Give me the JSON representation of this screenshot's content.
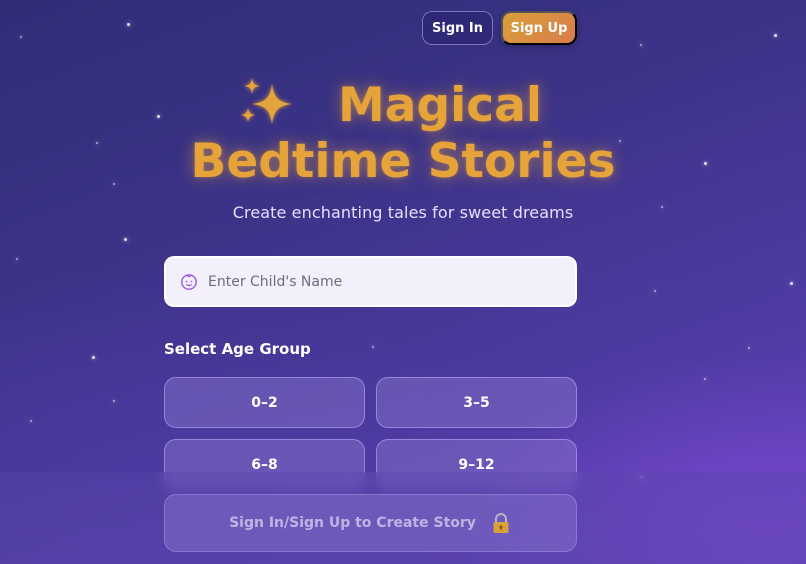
{
  "header": {
    "sign_in_label": "Sign In",
    "sign_up_label": "Sign Up"
  },
  "hero": {
    "title_line1": "Magical",
    "title_line2": "Bedtime Stories",
    "subtitle": "Create enchanting tales for sweet dreams",
    "icon": "sparkles-icon"
  },
  "form": {
    "name_placeholder": "Enter Child's Name",
    "name_value": "",
    "name_icon": "baby-face-icon",
    "age_group_label": "Select Age Group",
    "age_groups": [
      "0–2",
      "3–5",
      "6–8",
      "9–12"
    ],
    "create_button_label": "Sign In/Sign Up to Create Story",
    "create_button_icon": "lock-icon"
  },
  "colors": {
    "accent_gold": "#e5a33a",
    "sign_up_gradient_start": "#d9a03b",
    "sign_up_gradient_end": "#d97c4a",
    "background_dark": "#2f2d78",
    "background_light": "#6640c0"
  }
}
